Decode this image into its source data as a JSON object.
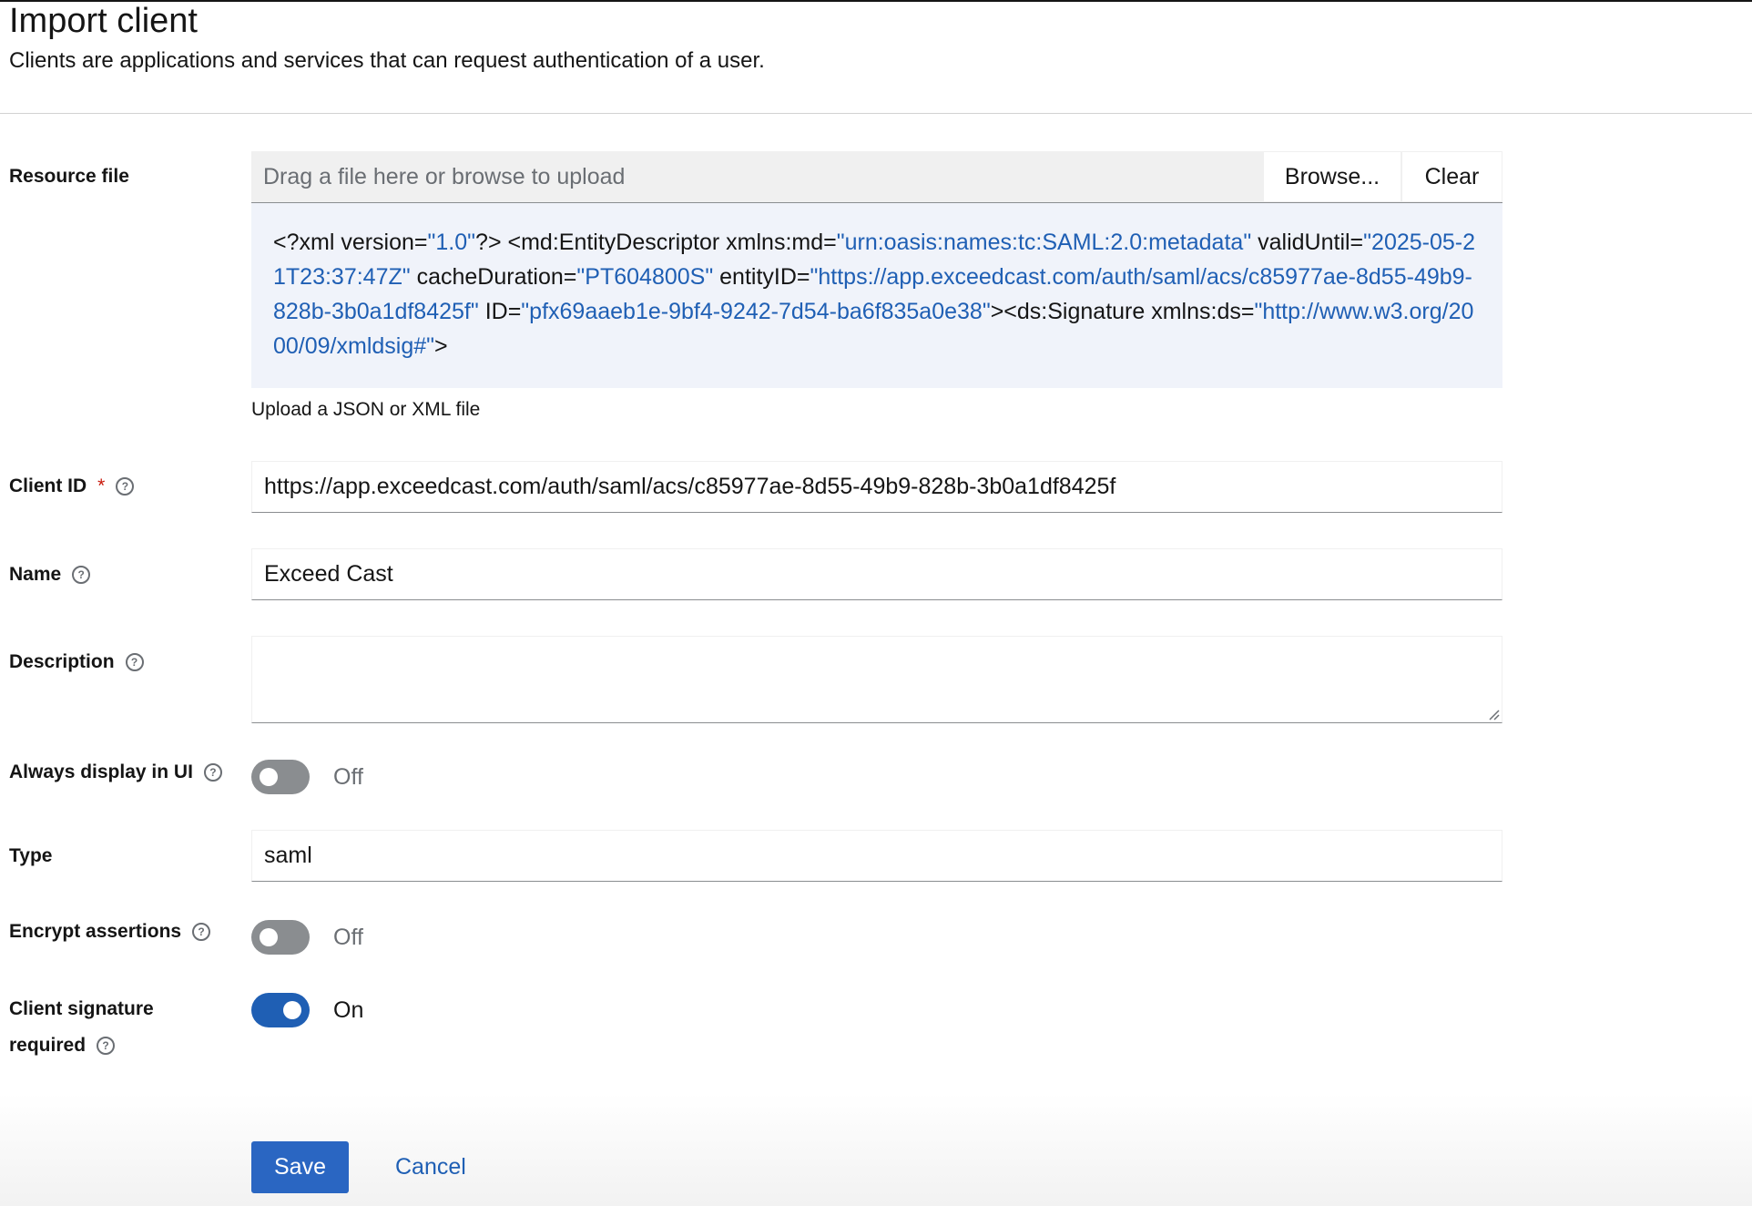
{
  "header": {
    "title": "Import client",
    "description": "Clients are applications and services that can request authentication of a user."
  },
  "resource_file": {
    "label": "Resource file",
    "placeholder": "Drag a file here or browse to upload",
    "browse_label": "Browse...",
    "clear_label": "Clear",
    "helper_text": "Upload a JSON or XML file",
    "code": {
      "s1": "<?xml version=",
      "v1": "\"1.0\"",
      "s2": "?> <md:EntityDescriptor xmlns:md=",
      "v2": "\"urn:oasis:names:tc:SAML:2.0:metadata\"",
      "s3": " validUntil=",
      "v3": "\"2025-05-21T23:37:47Z\"",
      "s4": " cacheDuration=",
      "v4": "\"PT604800S\"",
      "s5": " entityID=",
      "v5": "\"https://app.exceedcast.com/auth/saml/acs/c85977ae-8d55-49b9-828b-3b0a1df8425f\"",
      "s6": " ID=",
      "v6": "\"pfx69aaeb1e-9bf4-9242-7d54-ba6f835a0e38\"",
      "s7": "><ds:Signature xmlns:ds=",
      "v7": "\"http://www.w3.org/2000/09/xmldsig#\"",
      "s8": ">"
    }
  },
  "client_id": {
    "label": "Client ID",
    "required_mark": "*",
    "value": "https://app.exceedcast.com/auth/saml/acs/c85977ae-8d55-49b9-828b-3b0a1df8425f"
  },
  "name": {
    "label": "Name",
    "value": "Exceed Cast"
  },
  "description": {
    "label": "Description",
    "value": ""
  },
  "always_display": {
    "label": "Always display in UI",
    "state": "Off"
  },
  "type": {
    "label": "Type",
    "value": "saml"
  },
  "encrypt_assertions": {
    "label": "Encrypt assertions",
    "state": "Off"
  },
  "client_signature": {
    "label_line1": "Client signature",
    "label_line2": "required",
    "state": "On"
  },
  "actions": {
    "save_label": "Save",
    "cancel_label": "Cancel"
  },
  "help_glyph": "?",
  "colors": {
    "primary": "#2a66c2",
    "link": "#1f5fb4",
    "required": "#c9190b",
    "code_bg": "#f0f3fa"
  }
}
